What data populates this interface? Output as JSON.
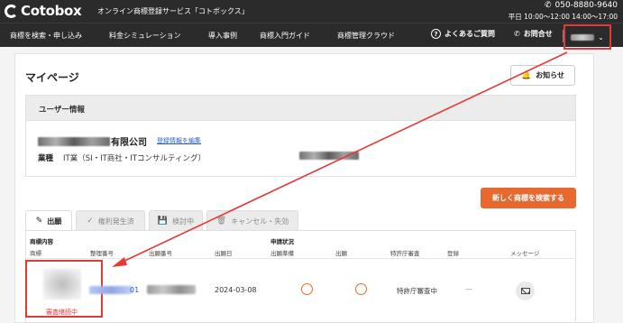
{
  "header": {
    "logo_text": "Cotobox",
    "tagline": "オンライン商標登録サービス「コトボックス」",
    "phone": "050-8880-9640",
    "hours": "平日 10:00〜12:00 14:00〜17:00"
  },
  "nav": {
    "items": [
      "商標を検索・申し込み",
      "料金シミュレーション",
      "導入事例",
      "商標入門ガイド",
      "商標管理クラウド"
    ],
    "faq": "よくあるご質問",
    "contact": "お問合せ"
  },
  "page": {
    "title": "マイページ",
    "notice_button": "お知らせ"
  },
  "user_info": {
    "section_title": "ユーザー情報",
    "company_suffix": "有限公司",
    "edit_link": "登録情報を編集",
    "industry_label": "業種",
    "industry_value": "IT業（SI・IT商社・ITコンサルティング）"
  },
  "actions": {
    "search_new": "新しく商標を検索する"
  },
  "tabs": [
    {
      "label": "出願",
      "icon": "pencil-icon",
      "active": true
    },
    {
      "label": "権利発生済",
      "icon": "check-icon",
      "active": false
    },
    {
      "label": "検討中",
      "icon": "save-icon",
      "active": false
    },
    {
      "label": "キャンセル・失効",
      "icon": "trash-icon",
      "active": false
    }
  ],
  "table": {
    "group_mark": "商標内容",
    "group_status": "申請状況",
    "columns": [
      "商標",
      "整理番号",
      "出願番号",
      "出願日",
      "出願準備",
      "出願",
      "特許庁審査",
      "登録",
      "メッセージ"
    ],
    "rows": [
      {
        "mark_status": "審査継続中",
        "ref_number_tail": "01",
        "filing_date": "2024-03-08",
        "review": "特許庁審査中",
        "registration": "—"
      }
    ]
  },
  "colors": {
    "accent": "#e8692f",
    "highlight": "#e53935",
    "header_bg": "#2b2b2b",
    "link": "#2a5fc9"
  }
}
